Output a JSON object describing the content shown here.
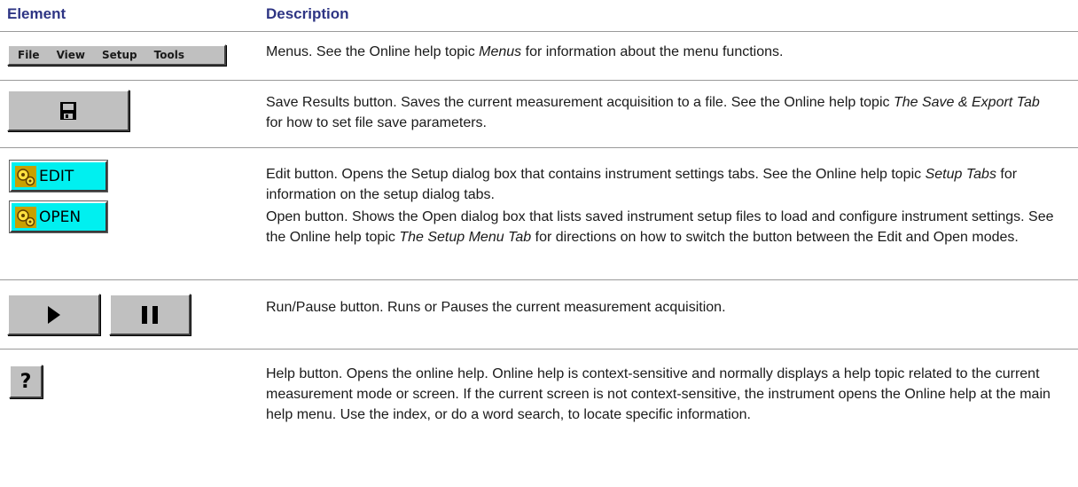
{
  "table": {
    "headers": {
      "element": "Element",
      "description": "Description"
    },
    "rows": [
      {
        "id": "menus",
        "menu_items": [
          "File",
          "View",
          "Setup",
          "Tools"
        ],
        "desc_pre": "Menus. See the Online help topic ",
        "desc_em": "Menus",
        "desc_post": " for information about the menu functions."
      },
      {
        "id": "save",
        "icon": "floppy-disk-icon",
        "desc_pre": "Save Results button. Saves the current measurement acquisition to a file. See the Online help topic ",
        "desc_em": "The Save & Export Tab",
        "desc_post": " for how to set file save parameters."
      },
      {
        "id": "edit",
        "label": "EDIT",
        "icon": "gear-edit-icon",
        "desc_pre": "Edit button. Opens the Setup dialog box that contains instrument settings tabs. See the Online help topic ",
        "desc_em": "Setup Tabs",
        "desc_post": " for information on the setup dialog tabs."
      },
      {
        "id": "open",
        "label": "OPEN",
        "icon": "gear-open-icon",
        "desc_pre": "Open button. Shows the Open dialog box that lists saved instrument setup files to load and configure instrument settings. See the Online help topic ",
        "desc_em": "The Setup Menu Tab",
        "desc_post": " for directions on how to switch the button between the Edit and Open modes."
      },
      {
        "id": "runpause",
        "icons": [
          "play-icon",
          "pause-icon"
        ],
        "desc_pre": "Run/Pause button. Runs or Pauses the current measurement acquisition.",
        "desc_em": "",
        "desc_post": ""
      },
      {
        "id": "help",
        "label": "?",
        "icon": "question-mark-icon",
        "desc_pre": "Help button. Opens the online help. Online help is context-sensitive and normally displays a help topic related to the current measurement mode or screen. If the current screen is not context-sensitive, the instrument opens the Online help at the main help menu. Use the index, or do a word search, to locate specific information.",
        "desc_em": "",
        "desc_post": ""
      }
    ]
  },
  "colors": {
    "header_text": "#2e3584",
    "button_face": "#c0c0c0",
    "cyan_button": "#00f0f0",
    "rule": "#9a9a9a"
  }
}
